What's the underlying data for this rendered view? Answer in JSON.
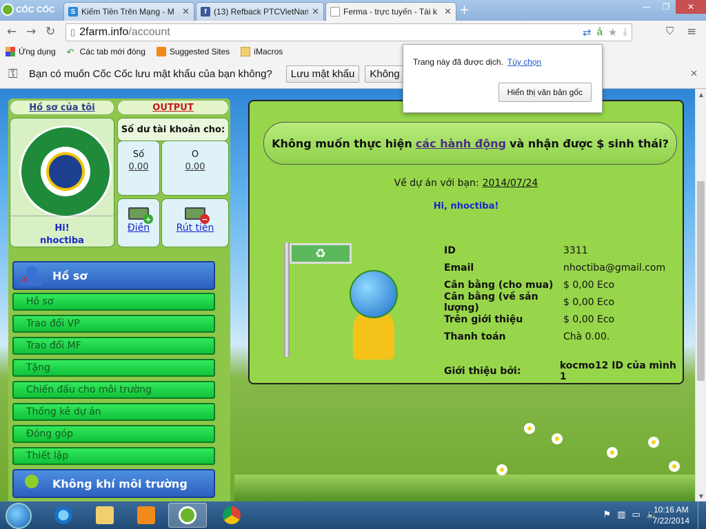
{
  "browser": {
    "brand": "CỐC CỐC",
    "tabs": [
      {
        "title": "Kiếm Tiền Trên Mạng - M",
        "favicon_color": "#2a8bd8",
        "favicon_letter": "S"
      },
      {
        "title": "(13) Refback PTCVietNam",
        "favicon_color": "#3b5998",
        "favicon_letter": "f"
      },
      {
        "title": "Ferma - trực tuyến - Tài k",
        "favicon_color": "#ffffff",
        "favicon_letter": ""
      }
    ],
    "url_domain": "2farm.info",
    "url_path": "/account",
    "bookmarks": [
      "Ứng dụng",
      "Các tab mới đóng",
      "Suggested Sites",
      "iMacros"
    ],
    "password_bar": {
      "question": "Bạn có muốn Cốc Cốc lưu mật khẩu của bạn không?",
      "save_label": "Lưu mật khẩu",
      "never_label": "Không bao"
    },
    "translate_popup": {
      "message": "Trang này đã được dịch.",
      "options_link": "Tùy chọn",
      "show_original": "Hiển thị văn bản gốc"
    }
  },
  "sidebar": {
    "profile_link": "Hồ sơ của tôi",
    "output_link": "OUTPUT",
    "balance_title": "Số dư tài khoản cho:",
    "greeting": "Hi!",
    "username": "nhoctiba",
    "balances": [
      {
        "label": "Số",
        "value": "0.00"
      },
      {
        "label": "O",
        "value": "0.00"
      }
    ],
    "deposit_label": "Điền",
    "withdraw_label": "Rút tiền",
    "section_profile": "Hồ sơ",
    "menu": [
      "Hồ sơ",
      "Trao đổi VP",
      "Trao đổi MF",
      "Tặng",
      "Chiến đấu cho môi trường",
      "Thống kê dự án",
      "Đóng góp",
      "Thiết lập"
    ],
    "section_air": "Không khí môi trường"
  },
  "main": {
    "banner_pre": "Không muốn thực hiện",
    "banner_link": "các hành động",
    "banner_post": "và nhận được $ sinh thái?",
    "about_label": "Về dự án với bạn:",
    "about_date": "2014/07/24",
    "greeting": "Hi, nhoctiba!",
    "info": [
      {
        "key": "ID",
        "value": "3311"
      },
      {
        "key": "Email",
        "value": "nhoctiba@gmail.com"
      },
      {
        "key": "Cân bằng (cho mua)",
        "value": "$ 0,00 Eco"
      },
      {
        "key": "Cân bằng (về sản lượng)",
        "value": "$ 0,00 Eco"
      },
      {
        "key": "Trên giới thiệu",
        "value": "$ 0,00 Eco"
      },
      {
        "key": "Thanh toán",
        "value": "Chà 0.00."
      }
    ],
    "referrer_key": "Giới thiệu bởi:",
    "referrer_value": "kocmo12 ID của mình 1"
  },
  "taskbar": {
    "time": "10:16 AM",
    "date": "7/22/2014"
  }
}
